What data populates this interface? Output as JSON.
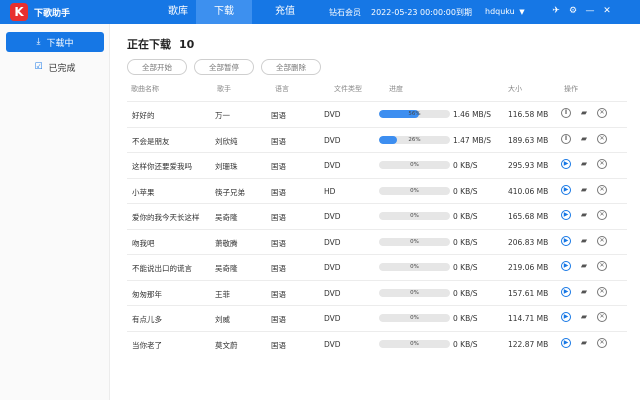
{
  "header": {
    "logo": "K",
    "title": "下歌助手",
    "tabs": [
      {
        "label": "歌库",
        "active": false
      },
      {
        "label": "下载",
        "active": true
      },
      {
        "label": "充值",
        "active": false
      }
    ],
    "vip": "钻石会员",
    "expiry": "2022-05-23 00:00:00到期",
    "user": "hdquku",
    "icons": [
      "pin-icon",
      "gear-icon",
      "minimize-icon",
      "close-icon"
    ]
  },
  "sidebar": {
    "items": [
      {
        "label": "下载中",
        "icon": "download-icon",
        "active": true
      },
      {
        "label": "已完成",
        "icon": "check-circle-icon",
        "active": false
      }
    ]
  },
  "main": {
    "title": "正在下载",
    "count": "10",
    "actions": [
      "全部开始",
      "全部暂停",
      "全部删除"
    ],
    "columns": [
      "歌曲名称",
      "歌手",
      "语言",
      "文件类型",
      "进度",
      "大小",
      "操作"
    ],
    "rows": [
      {
        "name": "好好的",
        "singer": "万一",
        "lang": "国语",
        "type": "DVD",
        "progress": 56,
        "pct": "56%",
        "speed": "1.46 MB/S",
        "size": "116.58 MB",
        "state": "downloading"
      },
      {
        "name": "不会是朋友",
        "singer": "刘欣纯",
        "lang": "国语",
        "type": "DVD",
        "progress": 26,
        "pct": "26%",
        "speed": "1.47 MB/S",
        "size": "189.63 MB",
        "state": "downloading"
      },
      {
        "name": "这样你还要爱我吗",
        "singer": "刘珊珠",
        "lang": "国语",
        "type": "DVD",
        "progress": 0,
        "pct": "0%",
        "speed": "0 KB/S",
        "size": "295.93 MB",
        "state": "waiting"
      },
      {
        "name": "小苹果",
        "singer": "筷子兄弟",
        "lang": "国语",
        "type": "HD",
        "progress": 0,
        "pct": "0%",
        "speed": "0 KB/S",
        "size": "410.06 MB",
        "state": "waiting"
      },
      {
        "name": "爱你的我今天长这样",
        "singer": "吴奇隆",
        "lang": "国语",
        "type": "DVD",
        "progress": 0,
        "pct": "0%",
        "speed": "0 KB/S",
        "size": "165.68 MB",
        "state": "waiting"
      },
      {
        "name": "吻我吧",
        "singer": "萧敬腾",
        "lang": "国语",
        "type": "DVD",
        "progress": 0,
        "pct": "0%",
        "speed": "0 KB/S",
        "size": "206.83 MB",
        "state": "waiting"
      },
      {
        "name": "不能说出口的谎言",
        "singer": "吴奇隆",
        "lang": "国语",
        "type": "DVD",
        "progress": 0,
        "pct": "0%",
        "speed": "0 KB/S",
        "size": "219.06 MB",
        "state": "waiting"
      },
      {
        "name": "匆匆那年",
        "singer": "王菲",
        "lang": "国语",
        "type": "DVD",
        "progress": 0,
        "pct": "0%",
        "speed": "0 KB/S",
        "size": "157.61 MB",
        "state": "waiting"
      },
      {
        "name": "有点儿多",
        "singer": "刘威",
        "lang": "国语",
        "type": "DVD",
        "progress": 0,
        "pct": "0%",
        "speed": "0 KB/S",
        "size": "114.71 MB",
        "state": "waiting"
      },
      {
        "name": "当你老了",
        "singer": "莫文蔚",
        "lang": "国语",
        "type": "DVD",
        "progress": 0,
        "pct": "0%",
        "speed": "0 KB/S",
        "size": "122.87 MB",
        "state": "waiting"
      }
    ]
  },
  "colors": {
    "accent": "#1677e5",
    "progress": "#3d8ef0",
    "logo": "#e83030"
  }
}
